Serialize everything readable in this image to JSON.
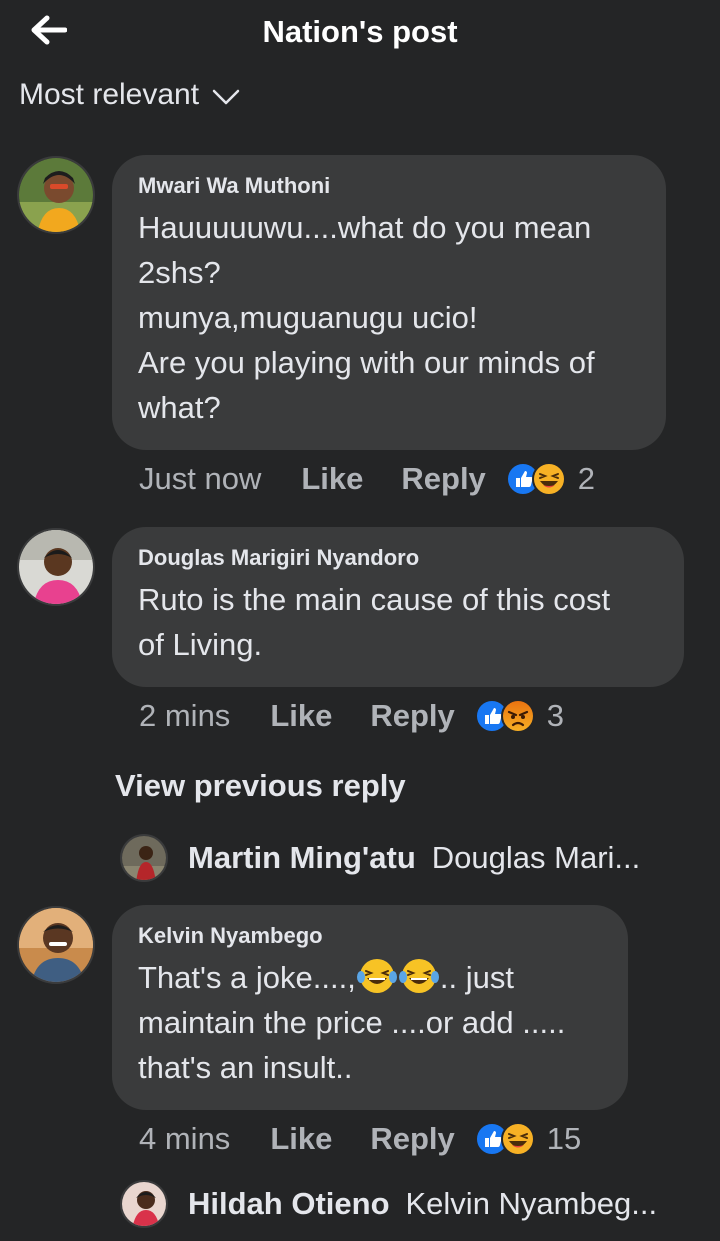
{
  "header": {
    "title": "Nation's post",
    "back_icon": "back-arrow-icon"
  },
  "sort": {
    "label": "Most relevant",
    "icon": "chevron-down-icon"
  },
  "comments": [
    {
      "author": "Mwari Wa Muthoni",
      "text": "Hauuuuuwu....what do you mean\n2shs?\nmunya,muguanugu ucio!\nAre you playing with our minds of\nwhat?",
      "time": "Just now",
      "like": "Like",
      "reply": "Reply",
      "reactions": [
        "like",
        "haha"
      ],
      "reaction_count": "2"
    },
    {
      "author": "Douglas Marigiri Nyandoro",
      "text": "Ruto is the main cause of this cost\nof Living.",
      "time": "2 mins",
      "like": "Like",
      "reply": "Reply",
      "reactions": [
        "like",
        "angry"
      ],
      "reaction_count": "3"
    },
    {
      "author": "Kelvin Nyambego",
      "text_line1_a": "That's a joke....,",
      "text_line1_b": ".. just",
      "text_rest": "maintain the price ....or add .....\nthat's an insult..",
      "time": "4 mins",
      "like": "Like",
      "reply": "Reply",
      "reactions": [
        "like",
        "haha"
      ],
      "reaction_count": "15"
    }
  ],
  "view_previous": "View previous reply",
  "replies": [
    {
      "name": "Martin Ming'atu",
      "preview": "Douglas Mari..."
    },
    {
      "name": "Hildah Otieno",
      "preview": "Kelvin Nyambeg..."
    }
  ],
  "colors": {
    "background": "#242526",
    "bubble": "#3a3b3c",
    "text": "#e4e6eb",
    "secondary": "#b0b3b8",
    "like_blue": "#1877f2",
    "haha_yellow": "#f7b125",
    "angry_orange": "#e9710f"
  }
}
